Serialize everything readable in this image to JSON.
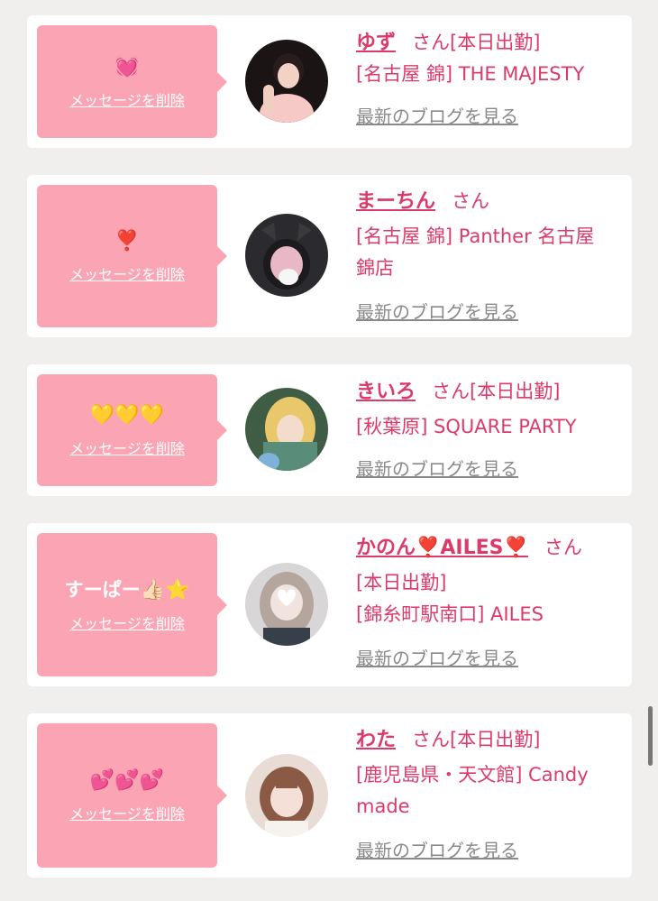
{
  "cards": [
    {
      "emoji": "💓",
      "delete_label": "メッセージを削除",
      "name": "ゆず",
      "san": "さん",
      "status": "[本日出勤]",
      "line2": "[名古屋 錦] THE MAJESTY",
      "line3": "",
      "blog": "最新のブログを見る"
    },
    {
      "emoji": "❣️",
      "delete_label": "メッセージを削除",
      "name": "まーちん",
      "san": "さん",
      "status": "",
      "line2": "[名古屋 錦] Panther 名古屋",
      "line3": "錦店",
      "blog": "最新のブログを見る"
    },
    {
      "emoji": "💛💛💛",
      "delete_label": "メッセージを削除",
      "name": "きいろ",
      "san": "さん",
      "status": "[本日出勤]",
      "line2": "[秋葉原] SQUARE PARTY",
      "line3": "",
      "blog": "最新のブログを見る"
    },
    {
      "emoji_text": "すーぱー",
      "emoji": "👍🏻⭐️",
      "delete_label": "メッセージを削除",
      "name": "かのん❣️AILES❣️",
      "san": "さん",
      "status": "[本日出勤]",
      "line2": "[錦糸町駅南口] AILES",
      "line3": "",
      "blog": "最新のブログを見る"
    },
    {
      "emoji": "💕💕💕",
      "delete_label": "メッセージを削除",
      "name": "わた",
      "san": "さん",
      "status": "[本日出勤]",
      "line2": "[鹿児島県・天文館] Candy",
      "line3": "made",
      "blog": "最新のブログを見る"
    }
  ],
  "colors": {
    "bubble": "#fba4b3",
    "accent": "#dc3a6a",
    "link_gray": "#8a8a8a",
    "background": "#f1eeee"
  }
}
